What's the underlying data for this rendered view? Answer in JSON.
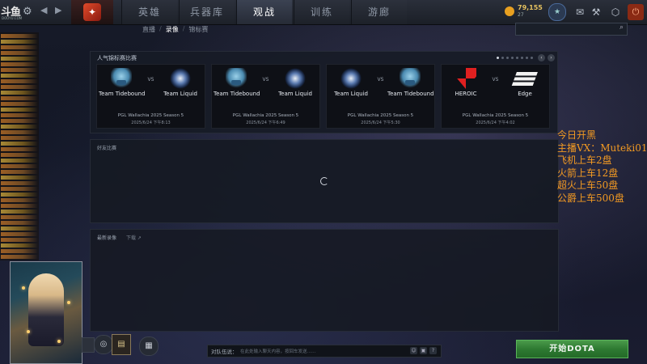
{
  "stream": {
    "logo_text": "斗鱼",
    "logo_sub": "DOUYU.COM",
    "overlay_lines": [
      "今日开黑",
      "主播VX：Muteki01",
      "飞机上车2盘",
      "火箭上车12盘",
      "超火上车50盘",
      "公爵上车500盘"
    ]
  },
  "topbar": {
    "tabs": [
      "英雄",
      "兵器库",
      "观战",
      "训练",
      "游廊"
    ],
    "active_tab": "观战",
    "coins": "79,155",
    "coins_sub": "27"
  },
  "subnav": {
    "items": [
      "直播",
      "录像",
      "锦标赛"
    ],
    "active": "录像"
  },
  "featured": {
    "title": "人气锦标赛比赛",
    "matches": [
      {
        "team1": "Team Tidebound",
        "logo1": "tidebound",
        "team2": "Team Liquid",
        "logo2": "liquid",
        "league": "PGL Wallachia 2025 Season 5",
        "date": "2025/6/24 下午8:13"
      },
      {
        "team1": "Team Tidebound",
        "logo1": "tidebound",
        "team2": "Team Liquid",
        "logo2": "liquid",
        "league": "PGL Wallachia 2025 Season 5",
        "date": "2025/6/24 下午6:49"
      },
      {
        "team1": "Team Liquid",
        "logo1": "liquid",
        "team2": "Team Tidebound",
        "logo2": "tidebound",
        "league": "PGL Wallachia 2025 Season 5",
        "date": "2025/6/24 下午5:30"
      },
      {
        "team1": "HEROIC",
        "logo1": "heroic",
        "team2": "Edge",
        "logo2": "edge",
        "league": "PGL Wallachia 2025 Season 5",
        "date": "2025/6/24 下午4:02"
      }
    ],
    "vs_label": "VS"
  },
  "live_panel": {
    "label": "好友比赛"
  },
  "recent_panel": {
    "label": "最新录像",
    "next_label": "下载 ↗"
  },
  "chatbar": {
    "label": "对队伍说：",
    "placeholder": "在此处输入聊天内容，按回车发送……",
    "btn1": "☺",
    "btn2": "?"
  },
  "play_button": "开始DOTA",
  "colors": {
    "overlay": "#f39a22",
    "play_green": "#2e7a32",
    "accent_red": "#8a2a14"
  },
  "icons": {
    "gear": "gear-icon",
    "back": "back-arrow-icon",
    "forward": "forward-arrow-icon",
    "search": "search-icon",
    "power": "power-icon"
  }
}
